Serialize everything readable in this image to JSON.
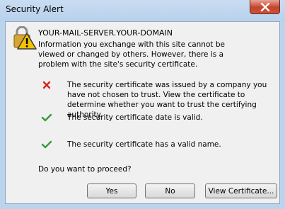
{
  "window": {
    "title": "Security Alert"
  },
  "header": {
    "server_name": "YOUR-MAIL-SERVER.YOUR-DOMAIN",
    "intro": "Information you exchange with this site cannot be viewed or changed by others. However, there is a problem with the site's security certificate."
  },
  "checks": [
    {
      "status": "error",
      "icon": "red-x-icon",
      "text": "The security certificate was issued by a company you have not chosen to trust. View the certificate to determine whether you want to trust the certifying authority."
    },
    {
      "status": "ok",
      "icon": "green-check-icon",
      "text": "The security certificate date is valid."
    },
    {
      "status": "ok",
      "icon": "green-check-icon",
      "text": "The security certificate has a valid name."
    }
  ],
  "question": "Do you want to proceed?",
  "buttons": {
    "yes": "Yes",
    "no": "No",
    "view_certificate": "View Certificate..."
  },
  "colors": {
    "error": "#d6231c",
    "ok": "#3a9a3a",
    "warning": "#f5c400"
  }
}
